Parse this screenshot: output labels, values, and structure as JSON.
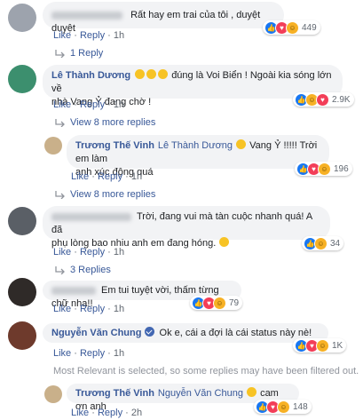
{
  "labels": {
    "like": "Like",
    "reply": "Reply",
    "dot": "·"
  },
  "comments": [
    {
      "text": "Rất hay em trai của tôi , duyệt duyệt",
      "time": "1h",
      "reactions": "449"
    },
    {
      "reply_link": "1 Reply"
    },
    {
      "name": "Lê Thành Dương",
      "text_a": "đúng là Voi Biển ! Ngoài kia sóng lớn về",
      "text_b": "nhà Vang Ỷ đang chờ !",
      "time": "1h",
      "reactions": "2.9K"
    },
    {
      "more": "View 8 more replies"
    },
    {
      "name": "Trương Thế Vinh",
      "mention": "Lê Thành Dương",
      "text_a": "Vang Ỷ !!!!! Trời em làm",
      "text_b": "anh xúc động quá",
      "time": "1h",
      "reactions": "196"
    },
    {
      "more": "View 8 more replies"
    },
    {
      "text_a": "Trời, đang vui mà tàn cuộc nhanh quá! A đã",
      "text_b": "phụ lòng bao nhiu anh em đang hóng.",
      "time": "1h",
      "reactions": "34"
    },
    {
      "reply_link": "3 Replies"
    },
    {
      "text_a": "Em tui tuyệt vời, thấm từng chữ nha!!",
      "time": "1h",
      "reactions": "79"
    },
    {
      "name": "Nguyễn Văn Chung",
      "text": "Ok e, cái a đợi là cái status này nè!",
      "time": "1h",
      "reactions": "1K"
    },
    {
      "note": "Most Relevant is selected, so some replies may have been filtered out."
    },
    {
      "name": "Trương Thế Vinh",
      "mention": "Nguyễn Văn Chung",
      "text": "cam ơn anh",
      "time": "2h",
      "reactions": "148"
    }
  ],
  "colors": {
    "link": "#385898",
    "bubble": "#f2f3f5",
    "like": "#1877f2",
    "love": "#f33e58",
    "haha": "#f7b125"
  }
}
